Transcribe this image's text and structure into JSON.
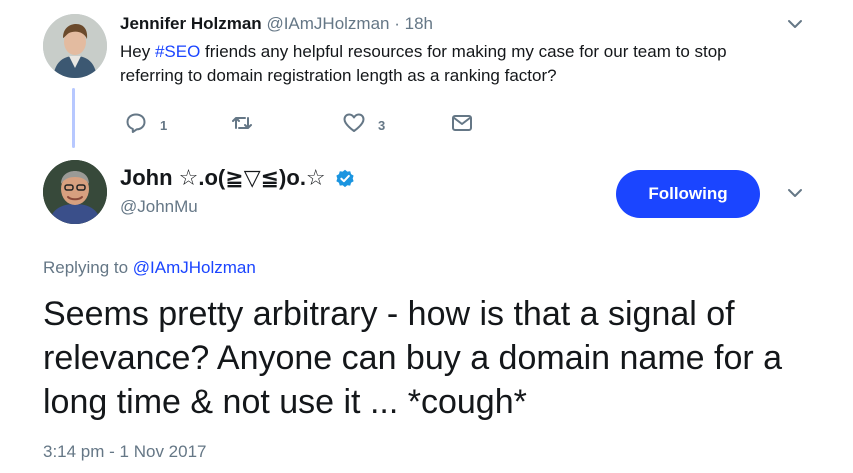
{
  "parent": {
    "name": "Jennifer Holzman",
    "handle": "@IAmJHolzman",
    "dot": " · ",
    "time": "18h",
    "text_before": "Hey ",
    "hashtag": "#SEO",
    "text_after": " friends any helpful resources for making my case for our team to stop referring to domain registration length as a ranking factor?",
    "reply_count": "1",
    "like_count": "3"
  },
  "reply": {
    "name": "John ☆.o(≧▽≦)o.☆",
    "handle": "@JohnMu",
    "follow_label": "Following",
    "replying_prefix": "Replying to ",
    "replying_handle": "@IAmJHolzman",
    "text": "Seems pretty arbitrary - how is that a signal of relevance? Anyone can buy a domain name for a long time & not use it ... *cough*",
    "timestamp": "3:14 pm - 1 Nov 2017"
  },
  "colors": {
    "accent": "#1b45ff",
    "muted": "#657786",
    "thread_line": "#b7c8ff"
  }
}
